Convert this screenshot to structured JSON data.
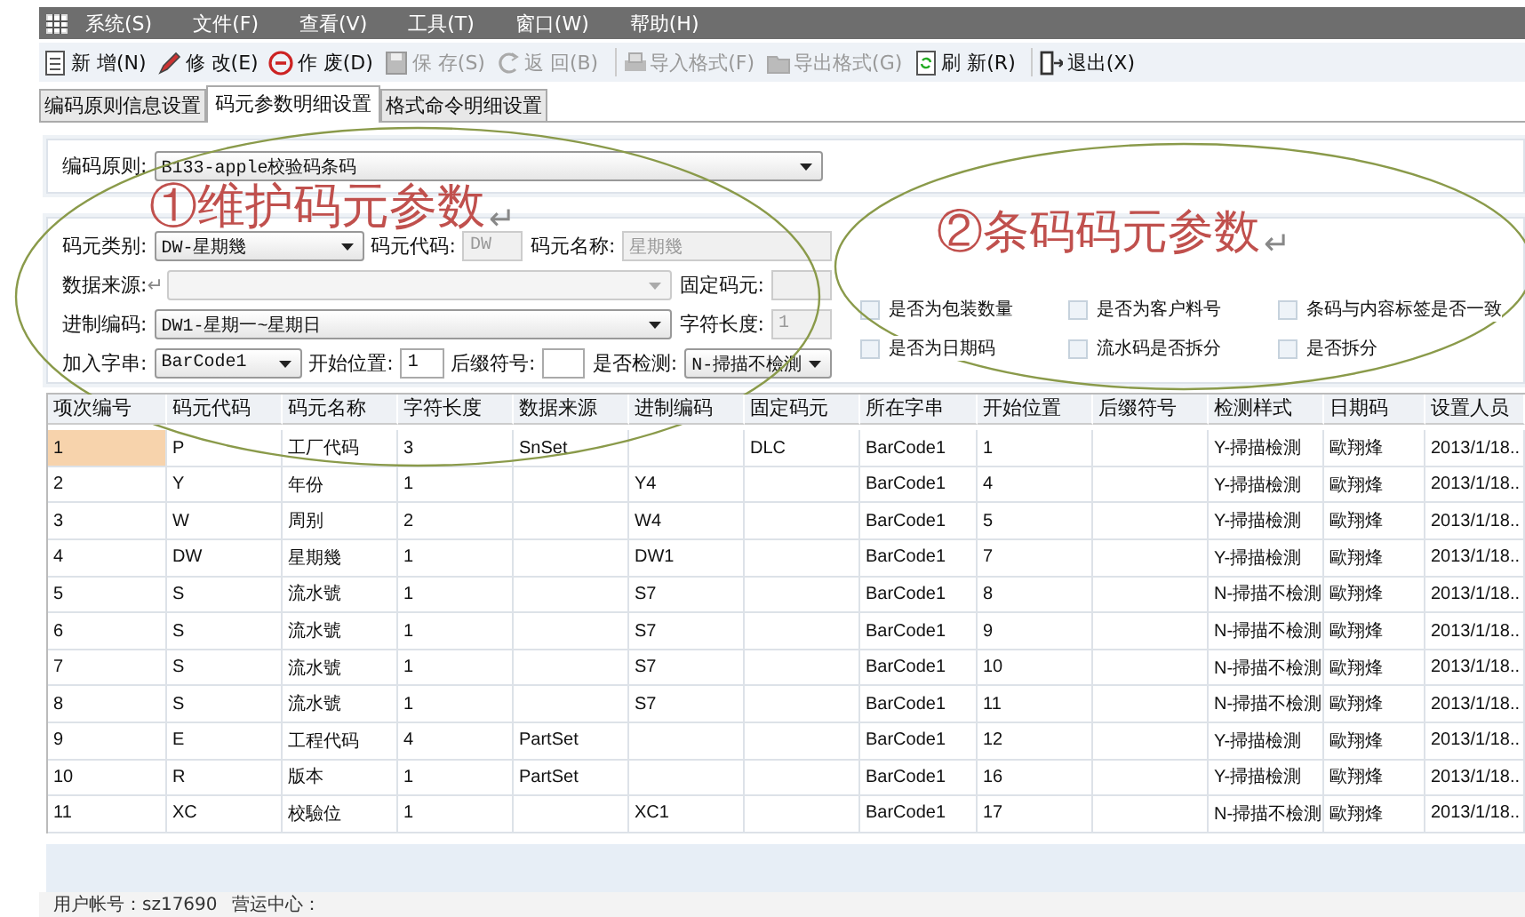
{
  "menu_bar": {
    "items": [
      "系统(S)",
      "文件(F)",
      "查看(V)",
      "工具(T)",
      "窗口(W)",
      "帮助(H)"
    ]
  },
  "toolbar": [
    {
      "label": "新 增(N)",
      "disabled": false
    },
    {
      "label": "修 改(E)",
      "disabled": false
    },
    {
      "label": "作 废(D)",
      "disabled": false
    },
    {
      "label": "保 存(S)",
      "disabled": true
    },
    {
      "label": "返 回(B)",
      "disabled": true
    },
    {
      "label": "导入格式(F)",
      "disabled": true
    },
    {
      "label": "导出格式(G)",
      "disabled": true
    },
    {
      "label": "刷 新(R)",
      "disabled": false
    },
    {
      "label": "退出(X)",
      "disabled": false
    }
  ],
  "tabs": [
    {
      "label": "编码原则信息设置",
      "selected": false
    },
    {
      "label": "码元参数明细设置",
      "selected": true
    },
    {
      "label": "格式命令明细设置",
      "selected": false
    }
  ],
  "rule_field": {
    "label": "编码原则:",
    "value": "B133-apple校验码条码"
  },
  "form": {
    "rows": [
      [
        {
          "kind": "combo",
          "label": "码元类别:",
          "value": "DW-星期幾",
          "disabled": false
        },
        {
          "kind": "code",
          "label": "码元代码:",
          "value": "DW",
          "disabled": true
        },
        {
          "kind": "text",
          "label": "码元名称:",
          "value": "星期幾",
          "disabled": true
        }
      ],
      [
        {
          "kind": "wide-combo",
          "label": "数据来源:",
          "mark": "↵",
          "disabled": true
        },
        {
          "kind": "code",
          "label": "固定码元:",
          "disabled": true
        }
      ],
      [
        {
          "kind": "wide-combo",
          "label": "进制编码:",
          "value": "DW1-星期一~星期日",
          "disabled": false
        },
        {
          "kind": "code",
          "label": "字符长度:",
          "value": "1",
          "disabled": true
        }
      ],
      [
        {
          "kind": "combo",
          "label": "加入字串:",
          "value": "BarCode1",
          "disabled": false
        },
        {
          "kind": "short",
          "label": "开始位置:",
          "value": "1",
          "disabled": false
        },
        {
          "kind": "short",
          "label": "后缀符号:",
          "disabled": false
        },
        {
          "kind": "combo",
          "label": "是否检测:",
          "value": "N-掃描不檢測",
          "disabled": false
        }
      ]
    ]
  },
  "options": [
    {
      "label": "是否为包装数量",
      "checked": false
    },
    {
      "label": "是否为客户料号",
      "checked": false
    },
    {
      "label": "条码与内容标签是否一致",
      "checked": false
    },
    {
      "label": "是否为日期码",
      "checked": false
    },
    {
      "label": "流水码是否拆分",
      "checked": false
    },
    {
      "label": "是否拆分",
      "checked": false
    }
  ],
  "table": {
    "columns": [
      "项次编号",
      "码元代码",
      "码元名称",
      "字符长度",
      "数据来源",
      "进制编码",
      "固定码元",
      "所在字串",
      "开始位置",
      "后缀符号",
      "检测样式",
      "日期码",
      "设置人员"
    ],
    "rows": [
      {
        "selected": true,
        "cells": [
          "1",
          "P",
          "工厂代码",
          "3",
          "SnSet",
          "",
          "DLC",
          "BarCode1",
          "1",
          "",
          "Y-掃描檢測",
          "歐翔烽",
          "2013/1/18.."
        ]
      },
      {
        "selected": false,
        "cells": [
          "2",
          "Y",
          "年份",
          "1",
          "",
          "Y4",
          "",
          "BarCode1",
          "4",
          "",
          "Y-掃描檢測",
          "歐翔烽",
          "2013/1/18.."
        ]
      },
      {
        "selected": false,
        "cells": [
          "3",
          "W",
          "周别",
          "2",
          "",
          "W4",
          "",
          "BarCode1",
          "5",
          "",
          "Y-掃描檢測",
          "歐翔烽",
          "2013/1/18.."
        ]
      },
      {
        "selected": false,
        "cells": [
          "4",
          "DW",
          "星期幾",
          "1",
          "",
          "DW1",
          "",
          "BarCode1",
          "7",
          "",
          "Y-掃描檢測",
          "歐翔烽",
          "2013/1/18.."
        ]
      },
      {
        "selected": false,
        "cells": [
          "5",
          "S",
          "流水號",
          "1",
          "",
          "S7",
          "",
          "BarCode1",
          "8",
          "",
          "N-掃描不檢測",
          "歐翔烽",
          "2013/1/18.."
        ]
      },
      {
        "selected": false,
        "cells": [
          "6",
          "S",
          "流水號",
          "1",
          "",
          "S7",
          "",
          "BarCode1",
          "9",
          "",
          "N-掃描不檢測",
          "歐翔烽",
          "2013/1/18.."
        ]
      },
      {
        "selected": false,
        "cells": [
          "7",
          "S",
          "流水號",
          "1",
          "",
          "S7",
          "",
          "BarCode1",
          "10",
          "",
          "N-掃描不檢測",
          "歐翔烽",
          "2013/1/18.."
        ]
      },
      {
        "selected": false,
        "cells": [
          "8",
          "S",
          "流水號",
          "1",
          "",
          "S7",
          "",
          "BarCode1",
          "11",
          "",
          "N-掃描不檢測",
          "歐翔烽",
          "2013/1/18.."
        ]
      },
      {
        "selected": false,
        "cells": [
          "9",
          "E",
          "工程代码",
          "4",
          "PartSet",
          "",
          "",
          "BarCode1",
          "12",
          "",
          "Y-掃描檢測",
          "歐翔烽",
          "2013/1/18.."
        ]
      },
      {
        "selected": false,
        "cells": [
          "10",
          "R",
          "版本",
          "1",
          "PartSet",
          "",
          "",
          "BarCode1",
          "16",
          "",
          "Y-掃描檢測",
          "歐翔烽",
          "2013/1/18.."
        ]
      },
      {
        "selected": false,
        "cells": [
          "11",
          "XC",
          "校驗位",
          "1",
          "",
          "XC1",
          "",
          "BarCode1",
          "17",
          "",
          "N-掃描不檢測",
          "歐翔烽",
          "2013/1/18.."
        ]
      }
    ]
  },
  "status_bar": [
    "用户帐号：sz17690",
    "营运中心："
  ],
  "annotations": [
    {
      "text": "①维护码元参数",
      "mark": "↵"
    },
    {
      "text": "②条码码元参数",
      "mark": "↵"
    }
  ]
}
